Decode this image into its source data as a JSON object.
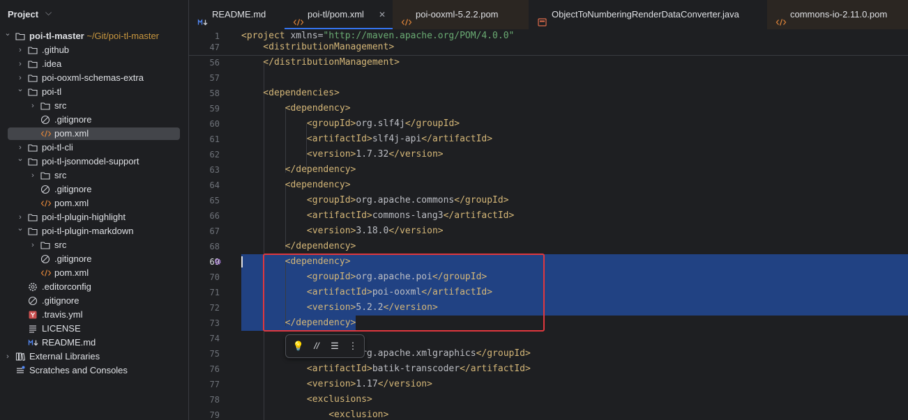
{
  "project_panel": {
    "title": "Project",
    "tree": [
      {
        "label": "poi-tl-master",
        "path": "~/Git/poi-tl-master",
        "depth": 0,
        "expanded": true,
        "kind": "folder",
        "bold": true
      },
      {
        "label": ".github",
        "depth": 1,
        "expanded": false,
        "kind": "folder"
      },
      {
        "label": ".idea",
        "depth": 1,
        "expanded": false,
        "kind": "folder"
      },
      {
        "label": "poi-ooxml-schemas-extra",
        "depth": 1,
        "expanded": false,
        "kind": "folder"
      },
      {
        "label": "poi-tl",
        "depth": 1,
        "expanded": true,
        "kind": "folder"
      },
      {
        "label": "src",
        "depth": 2,
        "expanded": false,
        "kind": "folder"
      },
      {
        "label": ".gitignore",
        "depth": 2,
        "kind": "ignore"
      },
      {
        "label": "pom.xml",
        "depth": 2,
        "kind": "xml",
        "selected": true
      },
      {
        "label": "poi-tl-cli",
        "depth": 1,
        "expanded": false,
        "kind": "folder"
      },
      {
        "label": "poi-tl-jsonmodel-support",
        "depth": 1,
        "expanded": true,
        "kind": "folder"
      },
      {
        "label": "src",
        "depth": 2,
        "expanded": false,
        "kind": "folder"
      },
      {
        "label": ".gitignore",
        "depth": 2,
        "kind": "ignore"
      },
      {
        "label": "pom.xml",
        "depth": 2,
        "kind": "xml"
      },
      {
        "label": "poi-tl-plugin-highlight",
        "depth": 1,
        "expanded": false,
        "kind": "folder"
      },
      {
        "label": "poi-tl-plugin-markdown",
        "depth": 1,
        "expanded": true,
        "kind": "folder"
      },
      {
        "label": "src",
        "depth": 2,
        "expanded": false,
        "kind": "folder"
      },
      {
        "label": ".gitignore",
        "depth": 2,
        "kind": "ignore"
      },
      {
        "label": "pom.xml",
        "depth": 2,
        "kind": "xml"
      },
      {
        "label": ".editorconfig",
        "depth": 1,
        "kind": "gear"
      },
      {
        "label": ".gitignore",
        "depth": 1,
        "kind": "ignore"
      },
      {
        "label": ".travis.yml",
        "depth": 1,
        "kind": "yaml"
      },
      {
        "label": "LICENSE",
        "depth": 1,
        "kind": "text"
      },
      {
        "label": "README.md",
        "depth": 1,
        "kind": "md"
      },
      {
        "label": "External Libraries",
        "depth": 0,
        "expanded": false,
        "kind": "libs"
      },
      {
        "label": "Scratches and Consoles",
        "depth": 0,
        "kind": "scratch"
      }
    ]
  },
  "tabs": [
    {
      "label": "README.md",
      "kind": "md"
    },
    {
      "label": "poi-tl/pom.xml",
      "kind": "xml",
      "active": true,
      "close": "✕"
    },
    {
      "label": "poi-ooxml-5.2.2.pom",
      "kind": "xml"
    },
    {
      "label": "ObjectToNumberingRenderDataConverter.java",
      "kind": "java"
    },
    {
      "label": "commons-io-2.11.0.pom",
      "kind": "xml"
    }
  ],
  "editor": {
    "sticky": [
      {
        "num": "1",
        "code": [
          [
            "tag",
            "<project "
          ],
          [
            "attr",
            "xmlns"
          ],
          [
            "txt",
            "="
          ],
          [
            "aval",
            "\"http://maven.apache.org/POM/4.0.0\""
          ]
        ]
      },
      {
        "num": "47",
        "code": [
          [
            "tag",
            "    <distributionManagement>"
          ]
        ]
      }
    ],
    "lines": [
      {
        "num": "56",
        "code": [
          [
            "tag",
            "    </distributionManagement>"
          ]
        ]
      },
      {
        "num": "57",
        "code": []
      },
      {
        "num": "58",
        "code": [
          [
            "tag",
            "    <dependencies>"
          ]
        ]
      },
      {
        "num": "59",
        "code": [
          [
            "tag",
            "        <dependency>"
          ]
        ]
      },
      {
        "num": "60",
        "code": [
          [
            "tag",
            "            <groupId>"
          ],
          [
            "txt",
            "org.slf4j"
          ],
          [
            "tag",
            "</groupId>"
          ]
        ]
      },
      {
        "num": "61",
        "code": [
          [
            "tag",
            "            <artifactId>"
          ],
          [
            "txt",
            "slf4j-api"
          ],
          [
            "tag",
            "</artifactId>"
          ]
        ]
      },
      {
        "num": "62",
        "code": [
          [
            "tag",
            "            <version>"
          ],
          [
            "txt",
            "1.7.32"
          ],
          [
            "tag",
            "</version>"
          ]
        ]
      },
      {
        "num": "63",
        "code": [
          [
            "tag",
            "        </dependency>"
          ]
        ]
      },
      {
        "num": "64",
        "code": [
          [
            "tag",
            "        <dependency>"
          ]
        ]
      },
      {
        "num": "65",
        "code": [
          [
            "tag",
            "            <groupId>"
          ],
          [
            "txt",
            "org.apache.commons"
          ],
          [
            "tag",
            "</groupId>"
          ]
        ]
      },
      {
        "num": "66",
        "code": [
          [
            "tag",
            "            <artifactId>"
          ],
          [
            "txt",
            "commons-lang3"
          ],
          [
            "tag",
            "</artifactId>"
          ]
        ]
      },
      {
        "num": "67",
        "code": [
          [
            "tag",
            "            <version>"
          ],
          [
            "txt",
            "3.18.0"
          ],
          [
            "tag",
            "</version>"
          ]
        ]
      },
      {
        "num": "68",
        "code": [
          [
            "tag",
            "        </dependency>"
          ]
        ]
      },
      {
        "num": "69",
        "code": [
          [
            "tag",
            "        <dependency>"
          ]
        ],
        "current": true
      },
      {
        "num": "70",
        "code": [
          [
            "tag",
            "            <groupId>"
          ],
          [
            "txt",
            "org.apache.poi"
          ],
          [
            "tag",
            "</groupId>"
          ]
        ]
      },
      {
        "num": "71",
        "code": [
          [
            "tag",
            "            <artifactId>"
          ],
          [
            "txt",
            "poi-ooxml"
          ],
          [
            "tag",
            "</artifactId>"
          ]
        ]
      },
      {
        "num": "72",
        "code": [
          [
            "tag",
            "            <version>"
          ],
          [
            "txt",
            "5.2.2"
          ],
          [
            "tag",
            "</version>"
          ]
        ]
      },
      {
        "num": "73",
        "code": [
          [
            "tag",
            "        </dependency>"
          ]
        ]
      },
      {
        "num": "74",
        "code": []
      },
      {
        "num": "75",
        "code": [
          [
            "tag",
            "            <groupId>"
          ],
          [
            "txt",
            "org.apache.xmlgraphics"
          ],
          [
            "tag",
            "</groupId>"
          ]
        ]
      },
      {
        "num": "76",
        "code": [
          [
            "tag",
            "            <artifactId>"
          ],
          [
            "txt",
            "batik-transcoder"
          ],
          [
            "tag",
            "</artifactId>"
          ]
        ]
      },
      {
        "num": "77",
        "code": [
          [
            "tag",
            "            <version>"
          ],
          [
            "txt",
            "1.17"
          ],
          [
            "tag",
            "</version>"
          ]
        ]
      },
      {
        "num": "78",
        "code": [
          [
            "tag",
            "            <exclusions>"
          ]
        ]
      },
      {
        "num": "79",
        "code": [
          [
            "tag",
            "                <exclusion>"
          ]
        ]
      }
    ]
  },
  "colors": {
    "selection": "#214283",
    "annotation": "#e0383e",
    "accent": "#3574f0"
  }
}
